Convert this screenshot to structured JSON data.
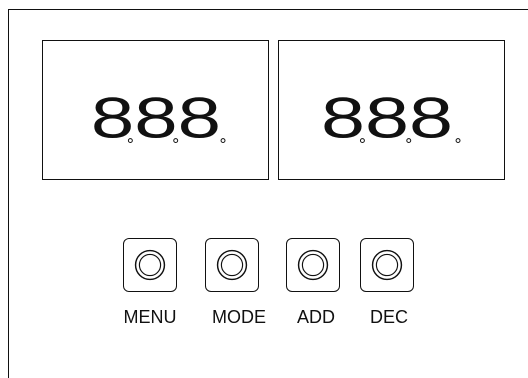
{
  "displays": [
    {
      "digits": "888",
      "decimal_points": 3
    },
    {
      "digits": "888",
      "decimal_points": 3
    }
  ],
  "buttons": [
    {
      "label": "MENU",
      "icon": "round-knob-icon"
    },
    {
      "label": "MODE",
      "icon": "round-knob-icon"
    },
    {
      "label": "ADD",
      "icon": "round-knob-icon"
    },
    {
      "label": "DEC",
      "icon": "round-knob-icon"
    }
  ]
}
